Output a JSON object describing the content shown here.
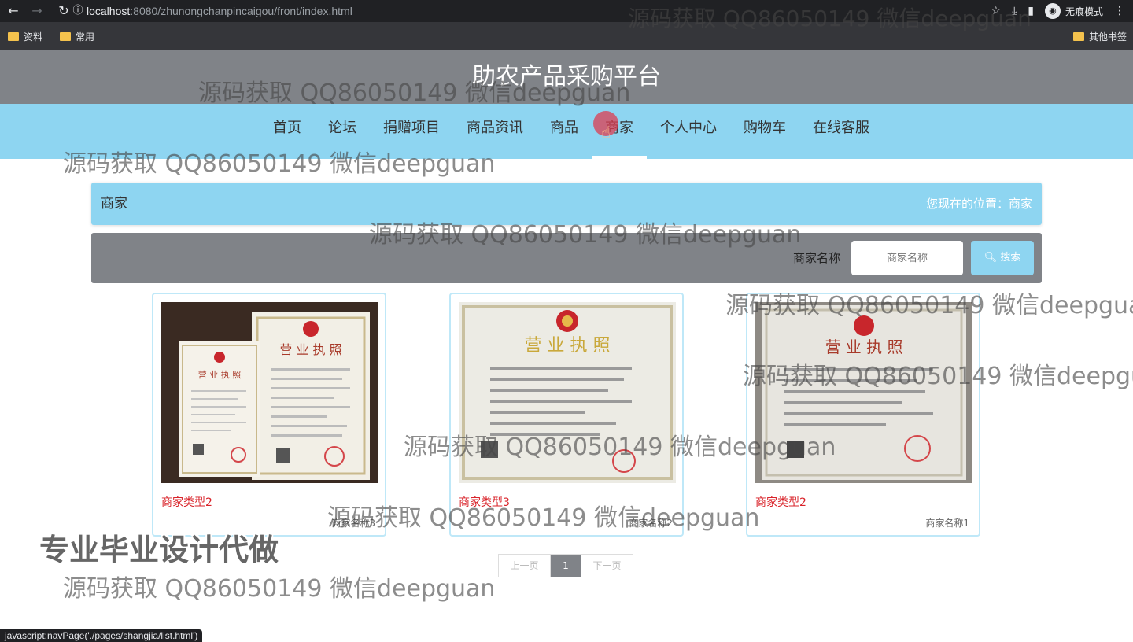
{
  "browser": {
    "url_host": "localhost",
    "url_rest": ":8080/zhunongchanpincaigou/front/index.html",
    "incognito_label": "无痕模式",
    "bookmarks": [
      "资料",
      "常用"
    ],
    "other_bookmarks": "其他书签",
    "status_url": "javascript:navPage('./pages/shangjia/list.html')"
  },
  "header": {
    "title": "助农产品采购平台"
  },
  "nav": {
    "items": [
      "首页",
      "论坛",
      "捐赠项目",
      "商品资讯",
      "商品",
      "商家",
      "个人中心",
      "购物车",
      "在线客服"
    ],
    "active": "商家"
  },
  "breadcrumb": {
    "title": "商家",
    "location": "您现在的位置：商家"
  },
  "search": {
    "label": "商家名称",
    "placeholder": "商家名称",
    "button_label": "搜索"
  },
  "merchants": [
    {
      "type": "商家类型2",
      "name": "商家名称3"
    },
    {
      "type": "商家类型3",
      "name": "商家名称2"
    },
    {
      "type": "商家类型2",
      "name": "商家名称1"
    }
  ],
  "pagination": {
    "prev": "上一页",
    "current": "1",
    "next": "下一页"
  },
  "overlay": {
    "watermark": "源码获取 QQ86050149 微信deepguan",
    "promo": "专业毕业设计代做"
  },
  "colors": {
    "accent": "#8ed5f1",
    "header_gray": "#808388",
    "type_red": "#d9232a"
  }
}
